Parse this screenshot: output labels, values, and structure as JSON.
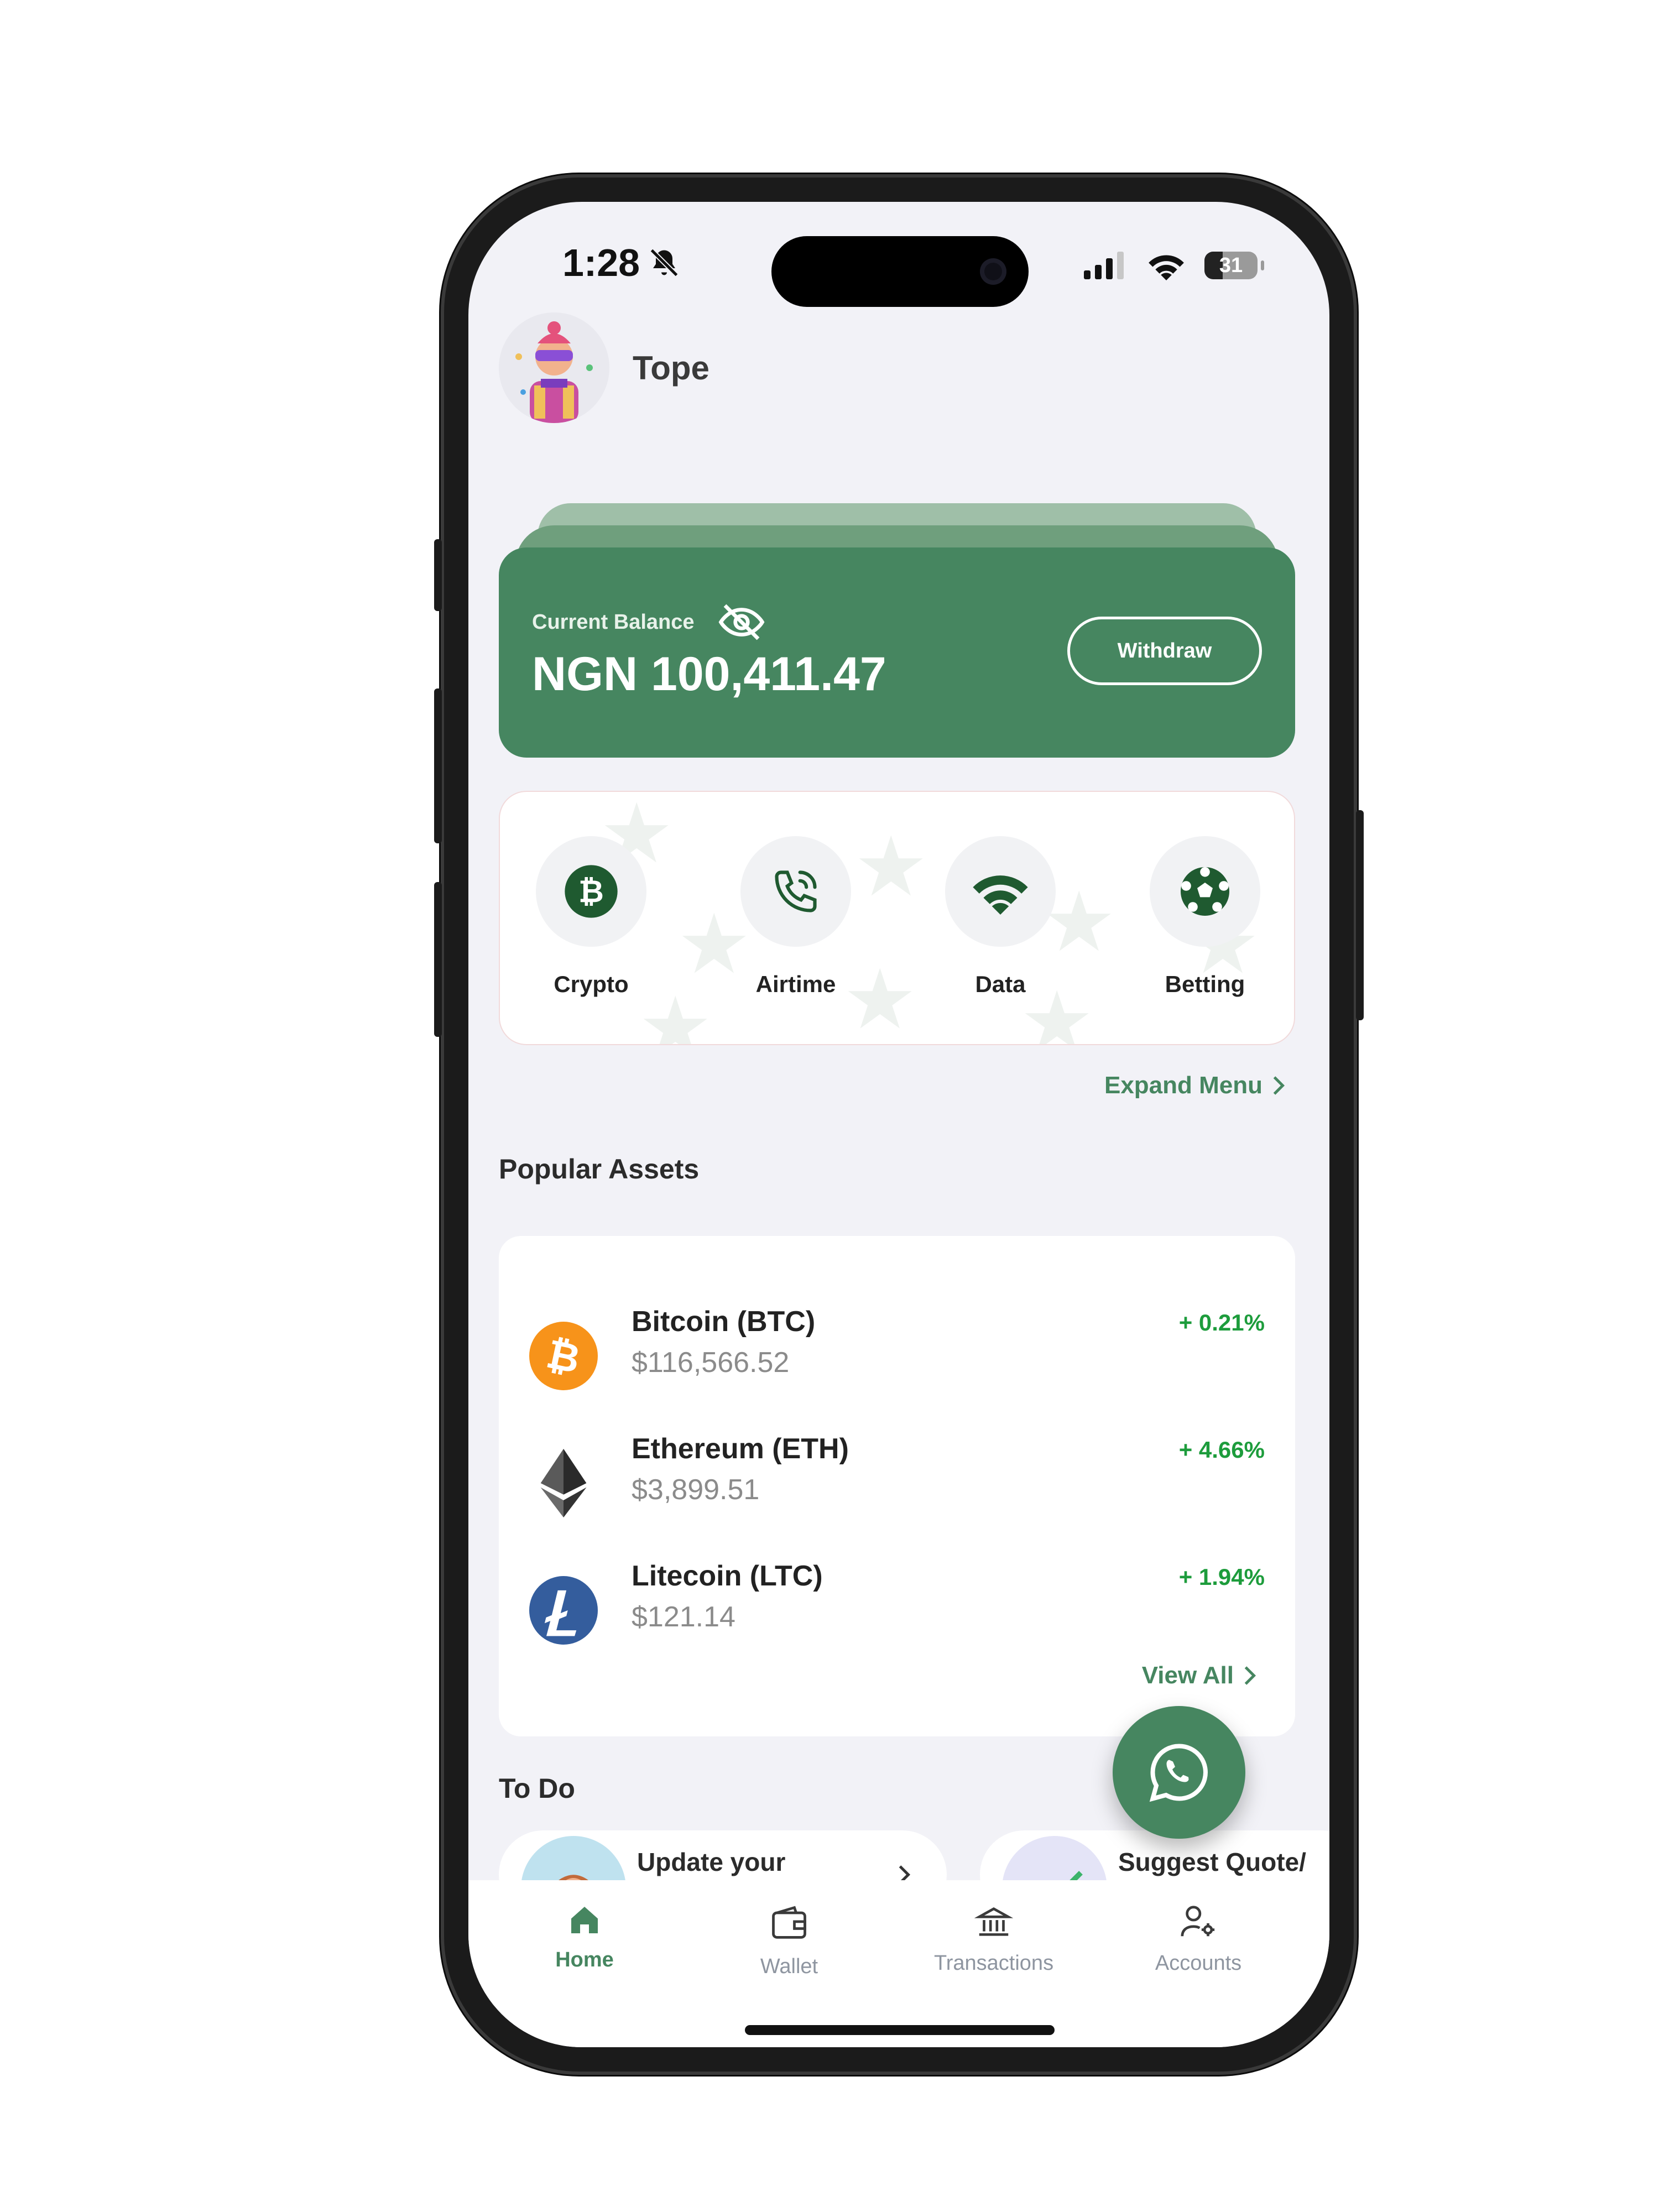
{
  "status_bar": {
    "time": "1:28",
    "battery": "31"
  },
  "header": {
    "username": "Tope"
  },
  "balance": {
    "label": "Current Balance",
    "amount": "NGN 100,411.47",
    "withdraw_label": "Withdraw"
  },
  "services": [
    {
      "label": "Crypto",
      "icon": "bitcoin-icon"
    },
    {
      "label": "Airtime",
      "icon": "phone-icon"
    },
    {
      "label": "Data",
      "icon": "wifi-icon"
    },
    {
      "label": "Betting",
      "icon": "soccer-ball-icon"
    }
  ],
  "expand_menu": "Expand Menu",
  "popular_assets": {
    "title": "Popular Assets",
    "items": [
      {
        "name": "Bitcoin (BTC)",
        "price": "$116,566.52",
        "change": "+ 0.21%",
        "icon": "bitcoin-coin-icon",
        "color": "#F7931A"
      },
      {
        "name": "Ethereum (ETH)",
        "price": "$3,899.51",
        "change": "+ 4.66%",
        "icon": "ethereum-icon",
        "color": "#3C3C3D"
      },
      {
        "name": "Litecoin (LTC)",
        "price": "$121.14",
        "change": "+ 1.94%",
        "icon": "litecoin-icon",
        "color": "#345D9D"
      }
    ],
    "view_all": "View All"
  },
  "todo": {
    "title": "To Do",
    "items": [
      {
        "text": "Update your"
      },
      {
        "text": "Suggest Quote/"
      }
    ]
  },
  "tabbar": [
    {
      "label": "Home",
      "icon": "home-icon",
      "active": true
    },
    {
      "label": "Wallet",
      "icon": "wallet-icon",
      "active": false
    },
    {
      "label": "Transactions",
      "icon": "bank-icon",
      "active": false
    },
    {
      "label": "Accounts",
      "icon": "user-settings-icon",
      "active": false
    }
  ],
  "colors": {
    "brand": "#468660",
    "positive": "#1D9C3C",
    "background": "#F2F2F7"
  }
}
